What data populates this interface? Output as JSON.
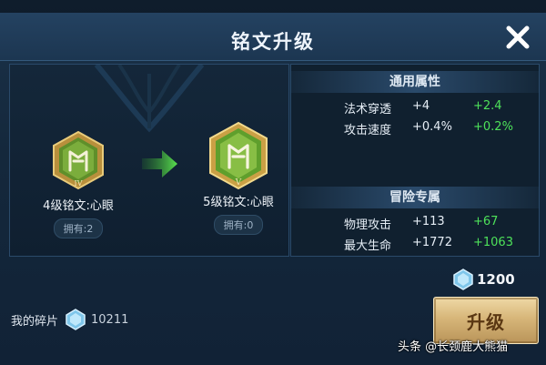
{
  "dialog": {
    "title": "铭文升级",
    "close_icon": "close-icon"
  },
  "current_rune": {
    "name": "4级铭文:心眼",
    "owned": "拥有:2",
    "tier_numeral": "IV",
    "icon": "rune-emblem-icon"
  },
  "next_rune": {
    "name": "5级铭文:心眼",
    "owned": "拥有:0",
    "tier_numeral": "V",
    "icon": "rune-emblem-icon"
  },
  "general_attributes": {
    "heading": "通用属性",
    "rows": [
      {
        "name": "法术穿透",
        "value": "+4",
        "increase": "+2.4"
      },
      {
        "name": "攻击速度",
        "value": "+0.4%",
        "increase": "+0.2%"
      }
    ]
  },
  "adventure_attributes": {
    "heading": "冒险专属",
    "rows": [
      {
        "name": "物理攻击",
        "value": "+113",
        "increase": "+67"
      },
      {
        "name": "最大生命",
        "value": "+1772",
        "increase": "+1063"
      }
    ]
  },
  "cost": {
    "amount": "1200",
    "icon": "crystal-icon"
  },
  "shards": {
    "label": "我的碎片",
    "amount": "10211",
    "icon": "crystal-icon"
  },
  "upgrade_button": {
    "label": "升级"
  },
  "watermark": "头条 @长颈鹿大熊猫",
  "colors": {
    "increase": "#4ee25a",
    "button_gold": "#d7b679",
    "panel": "#14283c"
  }
}
